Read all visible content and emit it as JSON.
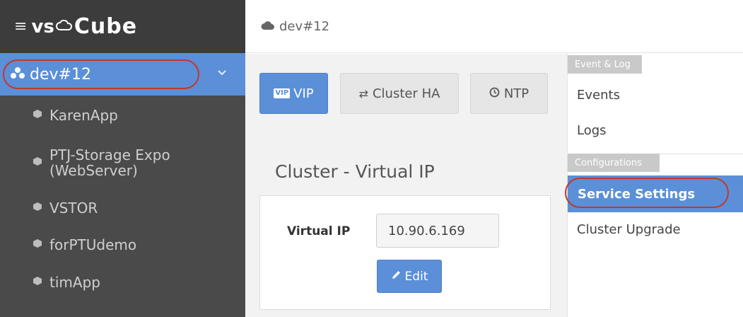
{
  "brand": {
    "menu_icon": "hamburger-menu-icon",
    "logo_part1": "vs",
    "logo_part2": "Cube"
  },
  "sidebar": {
    "active": {
      "label": "dev#12",
      "icon": "cluster-icon",
      "chevron": "chevron-down-icon"
    },
    "items": [
      {
        "label": "KarenApp",
        "icon": "box-icon"
      },
      {
        "label": "PTJ-Storage Expo",
        "label2": "(WebServer)",
        "icon": "box-icon"
      },
      {
        "label": "VSTOR",
        "icon": "box-icon"
      },
      {
        "label": "forPTUdemo",
        "icon": "box-icon"
      },
      {
        "label": "timApp",
        "icon": "box-icon"
      }
    ]
  },
  "header": {
    "title": "dev#12",
    "icon": "cloud-icon"
  },
  "tabs": [
    {
      "label": "VIP",
      "badge": "VIP",
      "active": true
    },
    {
      "label": "Cluster HA",
      "icon": "arrows-exchange-icon",
      "active": false
    },
    {
      "label": "NTP",
      "icon": "clock-icon",
      "active": false
    }
  ],
  "main": {
    "section_title": "Cluster - Virtual IP",
    "virtual_ip_label": "Virtual IP",
    "virtual_ip_value": "10.90.6.169",
    "edit_label": "Edit"
  },
  "right_panel": {
    "event_log_header": "Event & Log",
    "events_label": "Events",
    "logs_label": "Logs",
    "configurations_header": "Configurations",
    "service_settings_label": "Service Settings",
    "cluster_upgrade_label": "Cluster Upgrade"
  },
  "colors": {
    "accent": "#5b8fd8",
    "sidebar_bg": "#4a4a4a",
    "brand_bg": "#3c3c3c",
    "highlight_oval": "#c0392b"
  }
}
